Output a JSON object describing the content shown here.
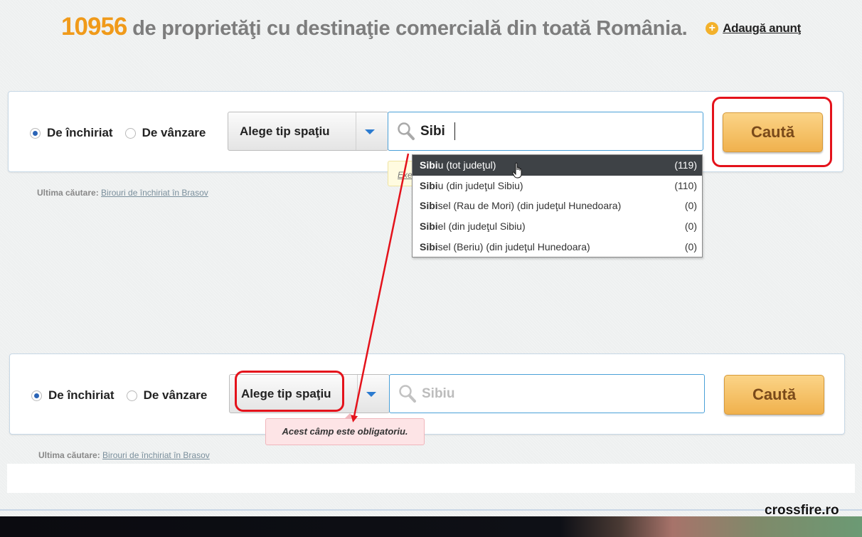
{
  "header": {
    "count": "10956",
    "text": " de proprietăţi cu destinaţie comercială din toată România.",
    "add_label": "Adaugă anunţ"
  },
  "form1": {
    "radio_rent": "De închiriat",
    "radio_sale": "De vânzare",
    "type_select": "Alege tip spaţiu",
    "search_value": "Sibi",
    "search_button": "Caută",
    "last_search_label": "Ultima căutare:",
    "last_search_link": "Birouri de închiriat în Brasov",
    "hint_text": "Exe"
  },
  "suggestions": [
    {
      "bold": "Sibi",
      "rest": "u (tot judeţul)",
      "count": "(119)"
    },
    {
      "bold": "Sibi",
      "rest": "u (din judeţul Sibiu)",
      "count": "(110)"
    },
    {
      "bold": "Sibi",
      "rest": "sel (Rau de Mori) (din judeţul Hunedoara)",
      "count": "(0)"
    },
    {
      "bold": "Sibi",
      "rest": "el (din judeţul Sibiu)",
      "count": "(0)"
    },
    {
      "bold": "Sibi",
      "rest": "sel (Beriu) (din judeţul Hunedoara)",
      "count": "(0)"
    }
  ],
  "form2": {
    "radio_rent": "De închiriat",
    "radio_sale": "De vânzare",
    "type_select": "Alege tip spaţiu",
    "search_placeholder": "Sibiu",
    "search_button": "Caută",
    "error_message": "Acest câmp este obligatoriu.",
    "last_search_label": "Ultima căutare:",
    "last_search_link": "Birouri de închiriat în Brasov"
  },
  "watermark": "crossfire.ro",
  "colors": {
    "count_orange": "#f09a1a",
    "annotation_red": "#e4121b",
    "accent_blue": "#2b64b6",
    "button_orange": "#f0b14d"
  }
}
